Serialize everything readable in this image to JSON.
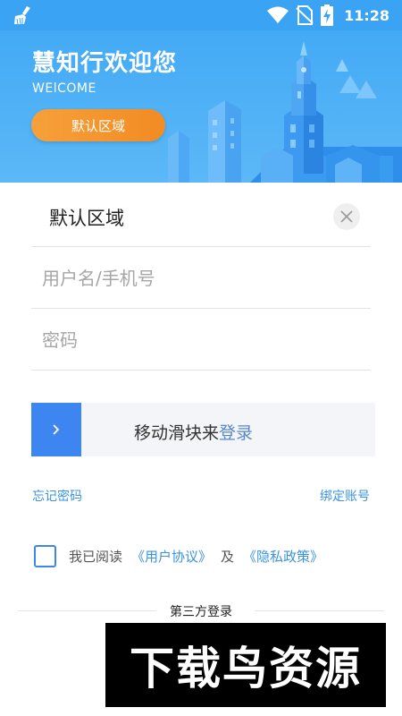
{
  "status_bar": {
    "time": "11:28",
    "icons": [
      "cleaner-broom-icon",
      "wifi-icon",
      "no-sim-icon",
      "battery-charging-icon"
    ]
  },
  "banner": {
    "title": "慧知行欢迎您",
    "subtitle": "WElCOME",
    "region_button": "默认区域"
  },
  "form": {
    "region_value": "默认区域",
    "username_placeholder": "用户名/手机号",
    "password_placeholder": "密码",
    "slider_prefix": "移动滑块来",
    "slider_highlight": "登录",
    "forgot_password": "忘记密码",
    "bind_account": "绑定账号"
  },
  "agreement": {
    "checked": false,
    "prefix": "我已阅读",
    "user_agreement": "《用户协议》",
    "and": "及",
    "privacy_policy": "《隐私政策》"
  },
  "third_party": {
    "title": "第三方登录"
  },
  "watermark": {
    "text": "下载鸟资源"
  },
  "colors": {
    "primary": "#3aa3f3",
    "accent_orange": "#f28b23",
    "slider_handle": "#3d86f1",
    "link": "#3a93e0"
  }
}
